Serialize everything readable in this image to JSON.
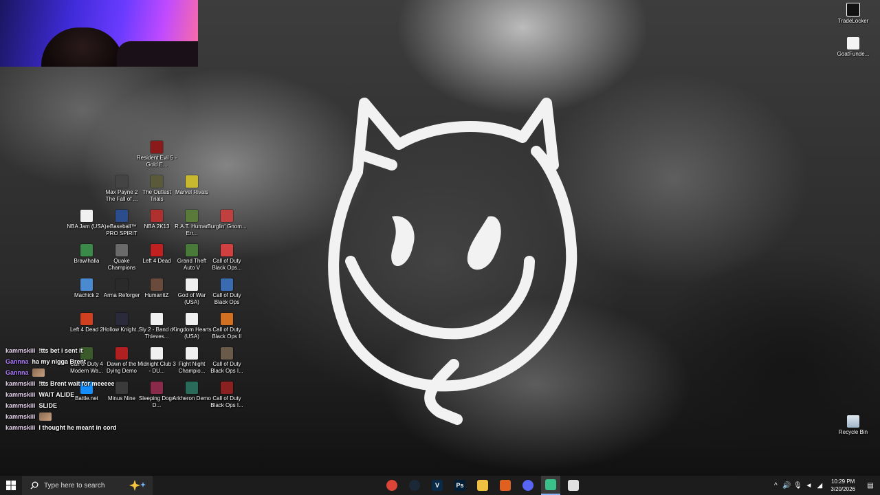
{
  "desktop_icons": [
    {
      "label": "Resident Evil 5 - Gold E...",
      "icon": "resident-evil-5-icon",
      "color": "#8b1a1a"
    },
    {
      "label": "Max Payne 2 The Fall of ...",
      "icon": "max-payne-2-icon",
      "color": "#444444"
    },
    {
      "label": "The Outlast Trials",
      "icon": "outlast-trials-icon",
      "color": "#5a5a3a"
    },
    {
      "label": "Marvel Rivals",
      "icon": "marvel-rivals-icon",
      "color": "#c8b830"
    },
    {
      "label": "NBA Jam (USA)",
      "icon": "file-icon",
      "color": "#f0f0f0"
    },
    {
      "label": "eBaseball™ PRO SPIRIT",
      "icon": "ebaseball-icon",
      "color": "#2b4d8c"
    },
    {
      "label": "NBA 2K13",
      "icon": "nba-2k13-icon",
      "color": "#b03030"
    },
    {
      "label": "R.A.T. Human Err...",
      "icon": "rat-icon",
      "color": "#5a7a3a"
    },
    {
      "label": "Burglin' Gnom...",
      "icon": "burglin-gnomes-icon",
      "color": "#c04040"
    },
    {
      "label": "Brawlhalla",
      "icon": "brawlhalla-icon",
      "color": "#3a8a4a"
    },
    {
      "label": "Quake Champions",
      "icon": "quake-champions-icon",
      "color": "#6a6a6a"
    },
    {
      "label": "Left 4 Dead",
      "icon": "left-4-dead-icon",
      "color": "#c02020"
    },
    {
      "label": "Grand Theft Auto V",
      "icon": "gta-v-icon",
      "color": "#4a7a3a"
    },
    {
      "label": "Call of Duty Black Ops...",
      "icon": "cod-black-ops-icon",
      "color": "#d04040"
    },
    {
      "label": "Machick 2",
      "icon": "machick-2-icon",
      "color": "#4a8ad0"
    },
    {
      "label": "Arma Reforger",
      "icon": "arma-reforger-icon",
      "color": "#2a2a2a"
    },
    {
      "label": "HumanitZ",
      "icon": "humanitz-icon",
      "color": "#6a4a3a"
    },
    {
      "label": "God of War (USA)",
      "icon": "file-icon",
      "color": "#f0f0f0"
    },
    {
      "label": "Call of Duty Black Ops",
      "icon": "cod-black-ops-icon",
      "color": "#3a6ab0"
    },
    {
      "label": "Left 4 Dead 2",
      "icon": "left-4-dead-2-icon",
      "color": "#d04020"
    },
    {
      "label": "Hollow Knight...",
      "icon": "hollow-knight-icon",
      "color": "#2a2a3a"
    },
    {
      "label": "Sly 2 - Band of Thieves...",
      "icon": "file-icon",
      "color": "#f0f0f0"
    },
    {
      "label": "Kingdom Hearts (USA)",
      "icon": "file-icon",
      "color": "#f0f0f0"
    },
    {
      "label": "Call of Duty Black Ops II",
      "icon": "cod-black-ops-2-icon",
      "color": "#d07020"
    },
    {
      "label": "Call of Duty 4 Modern Wa...",
      "icon": "cod-4-icon",
      "color": "#3a5a2a"
    },
    {
      "label": "Dawn of the Dying Demo",
      "icon": "dawn-dying-icon",
      "color": "#b02020"
    },
    {
      "label": "Midnight Club 3 - DU...",
      "icon": "file-icon",
      "color": "#f0f0f0"
    },
    {
      "label": "Fight Night Champio...",
      "icon": "file-icon",
      "color": "#f0f0f0"
    },
    {
      "label": "Call of Duty Black Ops I...",
      "icon": "cod-black-ops-icon",
      "color": "#6a5a4a"
    },
    {
      "label": "Battle.net",
      "icon": "battlenet-icon",
      "color": "#148eff"
    },
    {
      "label": "Minus Nine",
      "icon": "minus-nine-icon",
      "color": "#3a3a3a"
    },
    {
      "label": "Sleeping Dogs D...",
      "icon": "sleeping-dogs-icon",
      "color": "#8a2a4a"
    },
    {
      "label": "Arkheron Demo",
      "icon": "arkheron-icon",
      "color": "#2a6a5a"
    },
    {
      "label": "Call of Duty Black Ops I...",
      "icon": "cod-black-ops-icon",
      "color": "#8a2020"
    }
  ],
  "right_icons": [
    {
      "label": "TradeLocker",
      "icon": "tradelocker-icon"
    },
    {
      "label": "GoatFunde...",
      "icon": "goatfunded-icon"
    },
    {
      "label": "Recycle Bin",
      "icon": "recycle-bin-icon"
    }
  ],
  "chat": [
    {
      "user": "kammskiii",
      "user_color": "#e8d6f0",
      "message": "!tts bet i sent it",
      "emote": false
    },
    {
      "user": "Gannna",
      "user_color": "#b07cff",
      "message": "ha my nigga Brent",
      "emote": false
    },
    {
      "user": "Gannna",
      "user_color": "#b07cff",
      "message": "",
      "emote": true
    },
    {
      "user": "kammskiii",
      "user_color": "#e8d6f0",
      "message": "!tts Brent wait for meeeee",
      "emote": false
    },
    {
      "user": "kammskiii",
      "user_color": "#e8d6f0",
      "message": "WAIT ALIDE",
      "emote": false
    },
    {
      "user": "kammskiii",
      "user_color": "#e8d6f0",
      "message": "SLIDE",
      "emote": false
    },
    {
      "user": "kammskiii",
      "user_color": "#e8d6f0",
      "message": "",
      "emote": true
    },
    {
      "user": "kammskiii",
      "user_color": "#e8d6f0",
      "message": "I thought he meant in cord",
      "emote": false
    }
  ],
  "taskbar": {
    "search_placeholder": "Type here to search",
    "apps": [
      {
        "name": "chrome",
        "icon": "chrome-icon",
        "color": "#db4437",
        "glyph": ""
      },
      {
        "name": "steam",
        "icon": "steam-icon",
        "color": "#1b2838",
        "glyph": ""
      },
      {
        "name": "v",
        "icon": "v-app-icon",
        "color": "#0a2a4a",
        "glyph": "V"
      },
      {
        "name": "photoshop",
        "icon": "photoshop-icon",
        "color": "#001e36",
        "glyph": "Ps"
      },
      {
        "name": "file-explorer",
        "icon": "folder-icon",
        "color": "#f0c040",
        "glyph": ""
      },
      {
        "name": "app-orange",
        "icon": "orange-shield-icon",
        "color": "#e06020",
        "glyph": ""
      },
      {
        "name": "discord",
        "icon": "discord-icon",
        "color": "#5865f2",
        "glyph": ""
      },
      {
        "name": "active-app",
        "icon": "green-app-icon",
        "color": "#3ac08a",
        "glyph": ""
      },
      {
        "name": "window-app",
        "icon": "window-icon",
        "color": "#e0e0e0",
        "glyph": ""
      }
    ],
    "time": "10:29 PM",
    "date": "3/20/2026"
  }
}
